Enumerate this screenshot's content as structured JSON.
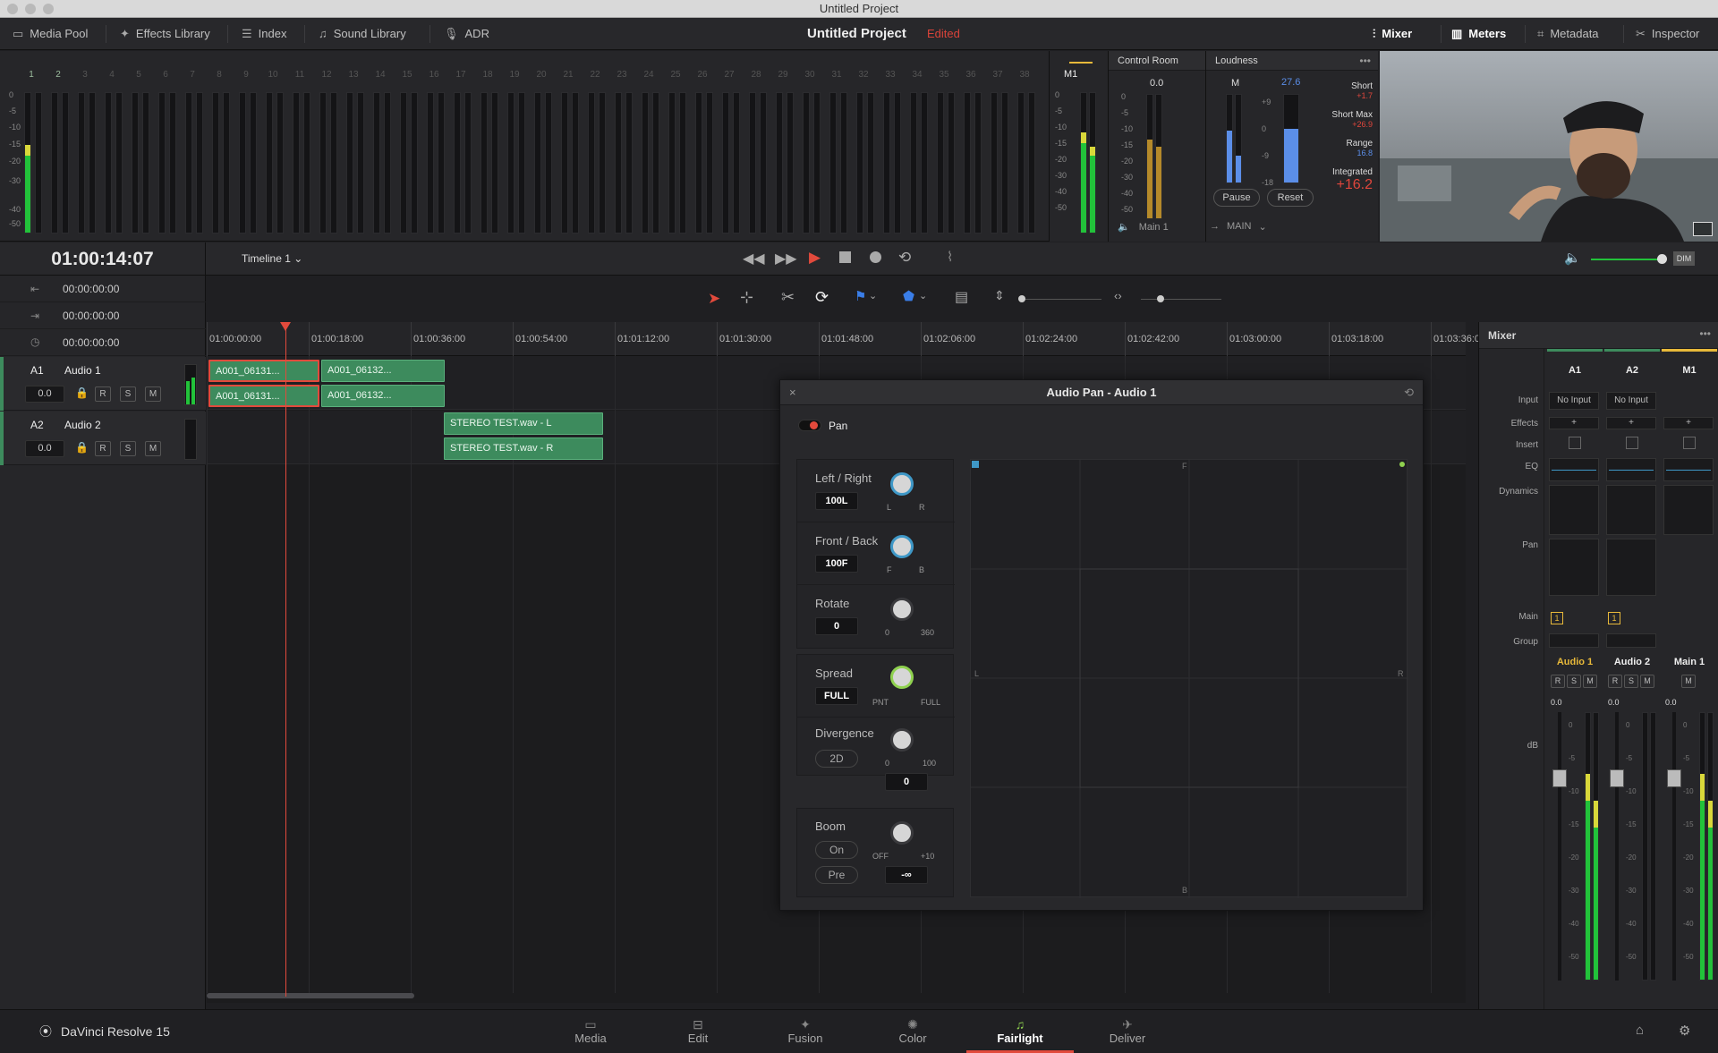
{
  "window_title": "Untitled Project",
  "topbar": {
    "left_items": [
      "Media Pool",
      "Effects Library",
      "Index",
      "Sound Library",
      "ADR"
    ],
    "project_name": "Untitled Project",
    "project_status": "Edited",
    "right_items": [
      "Mixer",
      "Meters",
      "Metadata",
      "Inspector"
    ]
  },
  "meters": {
    "channel_numbers": [
      "1",
      "2",
      "3",
      "4",
      "5",
      "6",
      "7",
      "8",
      "9",
      "10",
      "11",
      "12",
      "13",
      "14",
      "15",
      "16",
      "17",
      "18",
      "19",
      "20",
      "21",
      "22",
      "23",
      "24",
      "25",
      "26",
      "27",
      "28",
      "29",
      "30",
      "31",
      "32",
      "33",
      "34",
      "35",
      "36",
      "37",
      "38"
    ],
    "scale": [
      "0",
      "-5",
      "-10",
      "-15",
      "-20",
      "-30",
      "-40",
      "-50"
    ],
    "m1_label": "M1"
  },
  "control_room": {
    "title": "Control Room",
    "value": "0.0",
    "scale": [
      "0",
      "-5",
      "-10",
      "-15",
      "-20",
      "-30",
      "-40",
      "-50"
    ],
    "footer": "Main 1"
  },
  "loudness": {
    "title": "Loudness",
    "m_label": "M",
    "m_value": "27.6",
    "scale": [
      "+9",
      "0",
      "-9",
      "-18"
    ],
    "short_label": "Short",
    "short_value": "+1.7",
    "short_max_label": "Short Max",
    "short_max_value": "+26.9",
    "range_label": "Range",
    "range_value": "16.8",
    "integrated_label": "Integrated",
    "integrated_value": "+16.2",
    "pause": "Pause",
    "reset": "Reset",
    "footer": "MAIN"
  },
  "transport": {
    "timecode": "01:00:14:07",
    "timeline_name": "Timeline 1"
  },
  "timecodes": [
    "00:00:00:00",
    "00:00:00:00",
    "00:00:00:00"
  ],
  "tracks": [
    {
      "id": "A1",
      "name": "Audio 1",
      "vol": "0.0"
    },
    {
      "id": "A2",
      "name": "Audio 2",
      "vol": "0.0"
    }
  ],
  "track_buttons": [
    "R",
    "S",
    "M"
  ],
  "ruler": [
    "01:00:00:00",
    "01:00:18:00",
    "01:00:36:00",
    "01:00:54:00",
    "01:01:12:00",
    "01:01:30:00",
    "01:01:48:00",
    "01:02:06:00",
    "01:02:24:00",
    "01:02:42:00",
    "01:03:00:00",
    "01:03:18:00",
    "01:03:36:00"
  ],
  "clips": [
    "A001_06131...",
    "A001_06132...",
    "A001_06131...",
    "A001_06132...",
    "STEREO TEST.wav - L",
    "STEREO TEST.wav - R"
  ],
  "dialog": {
    "title": "Audio Pan - Audio 1",
    "pan_label": "Pan",
    "left_right": {
      "label": "Left / Right",
      "value": "100L",
      "min": "L",
      "max": "R"
    },
    "front_back": {
      "label": "Front / Back",
      "value": "100F",
      "min": "F",
      "max": "B"
    },
    "rotate": {
      "label": "Rotate",
      "value": "0",
      "min": "0",
      "max": "360"
    },
    "spread": {
      "label": "Spread",
      "value": "FULL",
      "min": "PNT",
      "max": "FULL"
    },
    "divergence": {
      "label": "Divergence",
      "mode": "2D",
      "value": "0",
      "min": "0",
      "max": "100"
    },
    "boom": {
      "label": "Boom",
      "on": "On",
      "pre": "Pre",
      "value": "-∞",
      "min": "OFF",
      "max": "+10"
    },
    "grid_labels": {
      "front": "F",
      "back": "B",
      "left": "L",
      "right": "R"
    }
  },
  "mixer": {
    "title": "Mixer",
    "channels": [
      "A1",
      "A2",
      "M1"
    ],
    "row_labels": [
      "Input",
      "Effects",
      "Insert",
      "EQ",
      "Dynamics",
      "Pan",
      "Main",
      "Group",
      "dB"
    ],
    "input_values": [
      "No Input",
      "No Input"
    ],
    "main_values": [
      "1",
      "1"
    ],
    "channel_names": [
      "Audio 1",
      "Audio 2",
      "Main 1"
    ],
    "fader_values": [
      "0.0",
      "0.0",
      "0.0"
    ],
    "fader_scale": [
      "0",
      "-5",
      "-10",
      "-15",
      "-20",
      "-30",
      "-40",
      "-50"
    ],
    "rsm": [
      "R",
      "S",
      "M"
    ],
    "m_only": "M"
  },
  "pages": [
    "Media",
    "Edit",
    "Fusion",
    "Color",
    "Fairlight",
    "Deliver"
  ],
  "active_page": "Fairlight",
  "app_name": "DaVinci Resolve 15",
  "colors": {
    "accent_red": "#e24a3c",
    "clip_green": "#3d8b5d",
    "meter_green": "#22c23a",
    "loudness_blue": "#5b8ee8",
    "active_gold": "#e8b93a"
  }
}
